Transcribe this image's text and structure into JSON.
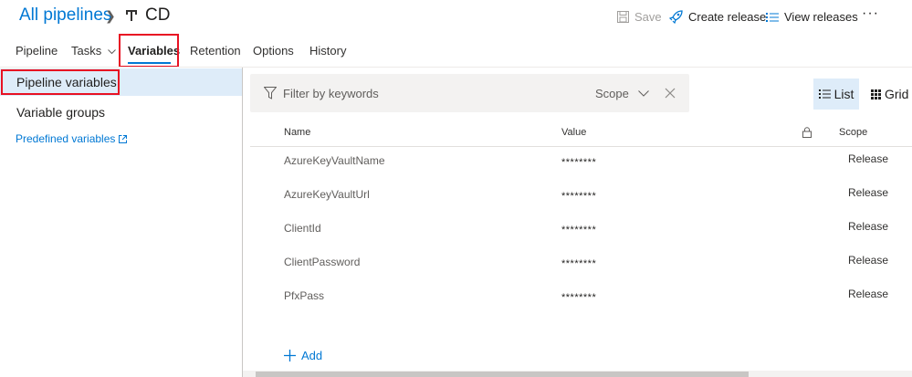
{
  "header": {
    "breadcrumb_root": "All pipelines",
    "breadcrumb_current": "CD",
    "save_label": "Save",
    "create_release_label": "Create release",
    "view_releases_label": "View releases",
    "more_label": "···"
  },
  "tabs": [
    {
      "label": "Pipeline"
    },
    {
      "label": "Tasks"
    },
    {
      "label": "Variables",
      "active": true
    },
    {
      "label": "Retention"
    },
    {
      "label": "Options"
    },
    {
      "label": "History"
    }
  ],
  "sidebar": {
    "pipeline_variables": "Pipeline variables",
    "variable_groups": "Variable groups",
    "predefined_variables": "Predefined variables"
  },
  "filter": {
    "placeholder": "Filter by keywords",
    "value": "",
    "scope_label": "Scope"
  },
  "view_toggle": {
    "list_label": "List",
    "grid_label": "Grid"
  },
  "table": {
    "columns": {
      "name": "Name",
      "value": "Value",
      "scope": "Scope"
    },
    "rows": [
      {
        "name": "AzureKeyVaultName",
        "value": "********",
        "scope": "Release"
      },
      {
        "name": "AzureKeyVaultUrl",
        "value": "********",
        "scope": "Release"
      },
      {
        "name": "ClientId",
        "value": "********",
        "scope": "Release"
      },
      {
        "name": "ClientPassword",
        "value": "********",
        "scope": "Release"
      },
      {
        "name": "PfxPass",
        "value": "********",
        "scope": "Release"
      }
    ],
    "add_label": "Add"
  },
  "colors": {
    "accent": "#0078d4",
    "selected_bg": "#deecf9",
    "highlight_box": "#e81123"
  }
}
